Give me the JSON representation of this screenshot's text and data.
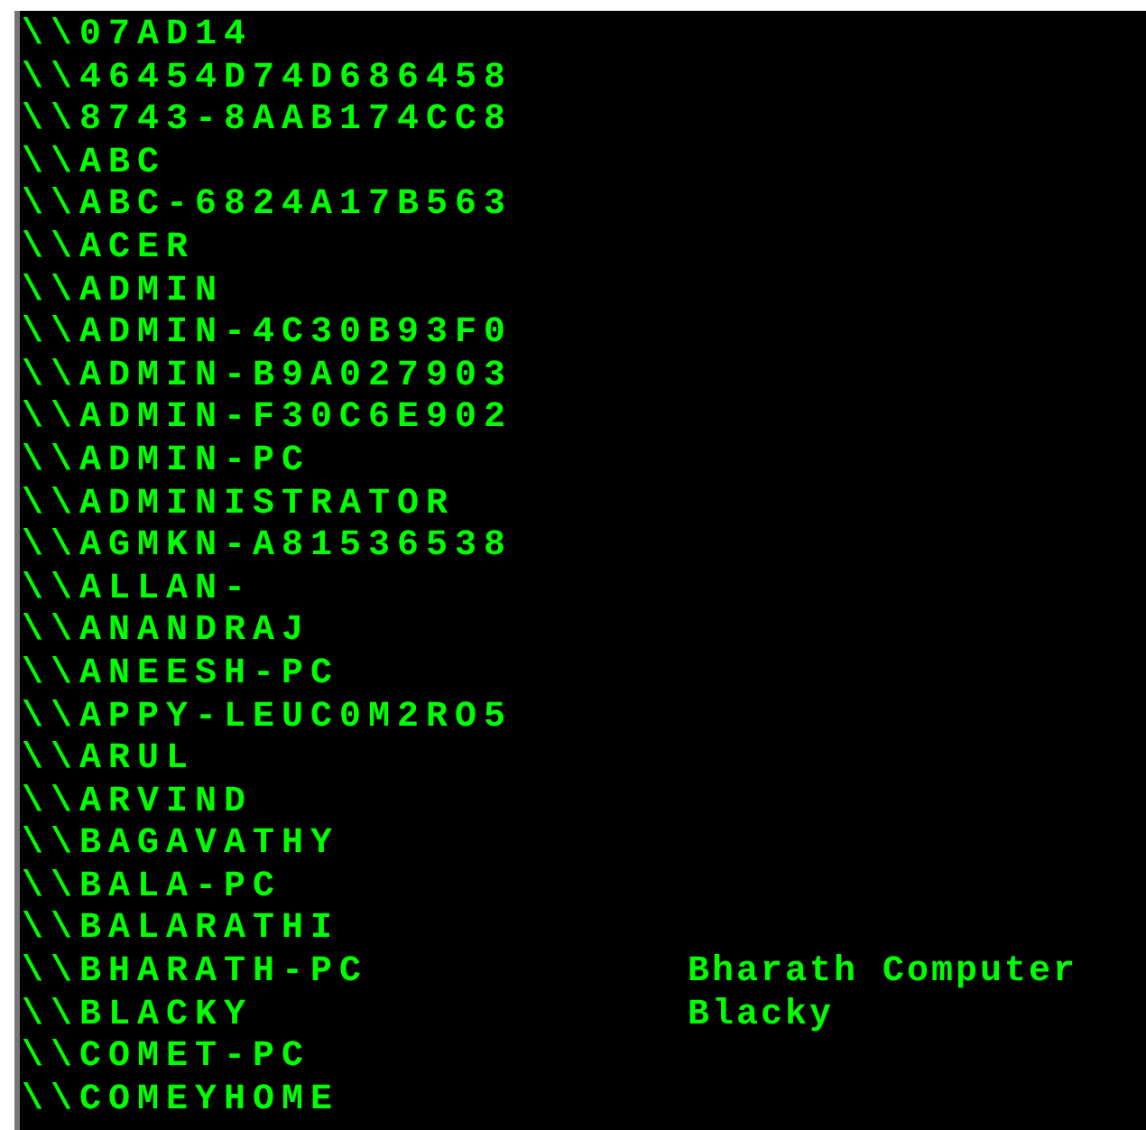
{
  "rows": [
    {
      "name": "\\\\07AD14"
    },
    {
      "name": "\\\\46454D74D686458"
    },
    {
      "name": "\\\\8743-8AAB174CC8"
    },
    {
      "name": "\\\\ABC"
    },
    {
      "name": "\\\\ABC-6824A17B563"
    },
    {
      "name": "\\\\ACER"
    },
    {
      "name": "\\\\ADMIN"
    },
    {
      "name": "\\\\ADMIN-4C30B93F0"
    },
    {
      "name": "\\\\ADMIN-B9A027903"
    },
    {
      "name": "\\\\ADMIN-F30C6E902"
    },
    {
      "name": "\\\\ADMIN-PC"
    },
    {
      "name": "\\\\ADMINISTRATOR"
    },
    {
      "name": "\\\\AGMKN-A81536538"
    },
    {
      "name": "\\\\ALLAN-"
    },
    {
      "name": "\\\\ANANDRAJ"
    },
    {
      "name": "\\\\ANEESH-PC"
    },
    {
      "name": "\\\\APPY-LEUC0M2RO5"
    },
    {
      "name": "\\\\ARUL"
    },
    {
      "name": "\\\\ARVIND"
    },
    {
      "name": "\\\\BAGAVATHY"
    },
    {
      "name": "\\\\BALA-PC"
    },
    {
      "name": "\\\\BALARATHI"
    },
    {
      "name": "\\\\BHARATH-PC",
      "remark": "Bharath Computer"
    },
    {
      "name": "\\\\BLACKY",
      "remark": "Blacky"
    },
    {
      "name": "\\\\COMET-PC"
    },
    {
      "name": "\\\\COMEYHOME"
    }
  ]
}
